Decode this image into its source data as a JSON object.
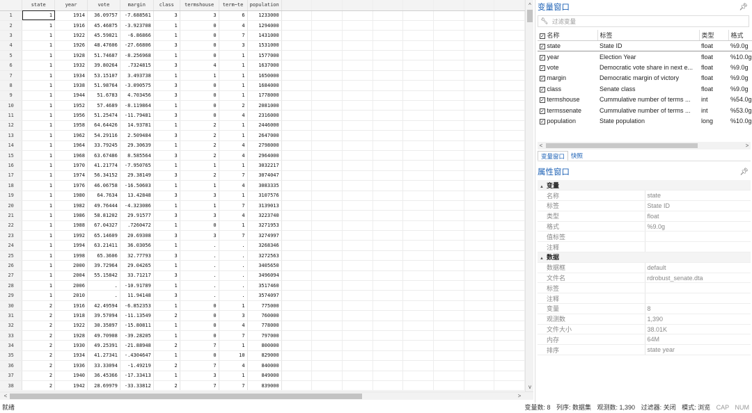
{
  "grid": {
    "columns": [
      "state",
      "year",
      "vote",
      "margin",
      "class",
      "termshouse",
      "term~te",
      "population"
    ],
    "rows": [
      [
        "1",
        "1914",
        "36.09757",
        "-7.688561",
        "3",
        "3",
        "6",
        "1233000"
      ],
      [
        "1",
        "1916",
        "45.46875",
        "-3.923708",
        "1",
        "0",
        "4",
        "1294000"
      ],
      [
        "1",
        "1922",
        "45.59821",
        "-6.86866",
        "1",
        "0",
        "7",
        "1431000"
      ],
      [
        "1",
        "1926",
        "48.47606",
        "-27.66806",
        "3",
        "0",
        "3",
        "1531000"
      ],
      [
        "1",
        "1928",
        "51.74687",
        "-8.256968",
        "1",
        "0",
        "1",
        "1577000"
      ],
      [
        "1",
        "1932",
        "39.80264",
        ".7324815",
        "3",
        "4",
        "1",
        "1637000"
      ],
      [
        "1",
        "1934",
        "53.15107",
        "3.493738",
        "1",
        "1",
        "1",
        "1650000"
      ],
      [
        "1",
        "1938",
        "51.98764",
        "-3.090575",
        "3",
        "0",
        "1",
        "1684000"
      ],
      [
        "1",
        "1944",
        "51.6783",
        "4.703456",
        "3",
        "0",
        "1",
        "1778000"
      ],
      [
        "1",
        "1952",
        "57.4689",
        "-8.119864",
        "1",
        "0",
        "2",
        "2081000"
      ],
      [
        "1",
        "1956",
        "51.25474",
        "-11.79481",
        "3",
        "0",
        "4",
        "2316000"
      ],
      [
        "1",
        "1958",
        "64.64426",
        "14.93781",
        "1",
        "2",
        "1",
        "2446000"
      ],
      [
        "1",
        "1962",
        "54.29116",
        "2.509484",
        "3",
        "2",
        "1",
        "2647000"
      ],
      [
        "1",
        "1964",
        "33.79245",
        "29.30639",
        "1",
        "2",
        "4",
        "2798000"
      ],
      [
        "1",
        "1968",
        "63.67486",
        "8.585564",
        "3",
        "2",
        "4",
        "2964000"
      ],
      [
        "1",
        "1970",
        "41.21774",
        "-7.950765",
        "1",
        "1",
        "1",
        "3032217"
      ],
      [
        "1",
        "1974",
        "56.34152",
        "29.38149",
        "3",
        "2",
        "7",
        "3074047"
      ],
      [
        "1",
        "1976",
        "46.06758",
        "-16.50603",
        "1",
        "1",
        "4",
        "3083335"
      ],
      [
        "1",
        "1980",
        "64.7634",
        "13.42848",
        "3",
        "3",
        "1",
        "3107576"
      ],
      [
        "1",
        "1982",
        "49.76444",
        "-4.323086",
        "1",
        "1",
        "7",
        "3139013"
      ],
      [
        "1",
        "1986",
        "58.81202",
        "29.91577",
        "3",
        "3",
        "4",
        "3223740"
      ],
      [
        "1",
        "1988",
        "67.04327",
        ".7260472",
        "1",
        "0",
        "1",
        "3271953"
      ],
      [
        "1",
        "1992",
        "65.14609",
        "20.69308",
        "3",
        "3",
        "7",
        "3274997"
      ],
      [
        "1",
        "1994",
        "63.21411",
        "36.03056",
        "1",
        ".",
        ".",
        "3268346"
      ],
      [
        "1",
        "1998",
        "65.3606",
        "32.77793",
        "3",
        ".",
        ".",
        "3272563"
      ],
      [
        "1",
        "2000",
        "39.72964",
        "29.04265",
        "1",
        ".",
        ".",
        "3405650"
      ],
      [
        "1",
        "2004",
        "55.15842",
        "33.71217",
        "3",
        ".",
        ".",
        "3496094"
      ],
      [
        "1",
        "2006",
        ".",
        "-10.91789",
        "1",
        ".",
        ".",
        "3517460"
      ],
      [
        "1",
        "2010",
        ".",
        "11.94148",
        "3",
        ".",
        ".",
        "3574097"
      ],
      [
        "2",
        "1916",
        "42.49594",
        "-6.852353",
        "1",
        "0",
        "1",
        "775000"
      ],
      [
        "2",
        "1918",
        "39.57094",
        "-11.13549",
        "2",
        "0",
        "3",
        "760000"
      ],
      [
        "2",
        "1922",
        "30.35897",
        "-15.80811",
        "1",
        "0",
        "4",
        "778000"
      ],
      [
        "2",
        "1928",
        "49.70908",
        "-39.28205",
        "1",
        "0",
        "7",
        "797000"
      ],
      [
        "2",
        "1930",
        "49.25391",
        "-21.88948",
        "2",
        "7",
        "1",
        "800000"
      ],
      [
        "2",
        "1934",
        "41.27341",
        "-.4304647",
        "1",
        "0",
        "10",
        "829000"
      ],
      [
        "2",
        "1936",
        "33.33094",
        "-1.49219",
        "2",
        "7",
        "4",
        "840000"
      ],
      [
        "2",
        "1940",
        "36.45366",
        "-17.33413",
        "1",
        "3",
        "1",
        "849000"
      ],
      [
        "2",
        "1942",
        "28.69979",
        "-33.33812",
        "2",
        "7",
        "7",
        "839000"
      ]
    ]
  },
  "variables_window": {
    "title": "变量窗口",
    "pin_icon": "pin-icon",
    "filter_placeholder": "过滤变量",
    "headers": [
      "名称",
      "标签",
      "类型",
      "格式"
    ],
    "variables": [
      {
        "name": "state",
        "label": "State ID",
        "type": "float",
        "format": "%9.0g"
      },
      {
        "name": "year",
        "label": "Election Year",
        "type": "float",
        "format": "%10.0g"
      },
      {
        "name": "vote",
        "label": "Democratic vote share in next e...",
        "type": "float",
        "format": "%9.0g"
      },
      {
        "name": "margin",
        "label": "Democratic margin of victory",
        "type": "float",
        "format": "%9.0g"
      },
      {
        "name": "class",
        "label": "Senate class",
        "type": "float",
        "format": "%9.0g"
      },
      {
        "name": "termshouse",
        "label": "Cummulative number of terms ...",
        "type": "int",
        "format": "%54.0g"
      },
      {
        "name": "termssenate",
        "label": "Cummulative number of terms ...",
        "type": "int",
        "format": "%53.0g"
      },
      {
        "name": "population",
        "label": "State population",
        "type": "long",
        "format": "%10.0g"
      }
    ],
    "tabs": [
      "变量窗口",
      "快照"
    ]
  },
  "properties_window": {
    "title": "属性窗口",
    "sections": [
      {
        "name": "变量",
        "rows": [
          {
            "label": "名称",
            "value": "state"
          },
          {
            "label": "标签",
            "value": "State ID"
          },
          {
            "label": "类型",
            "value": "float"
          },
          {
            "label": "格式",
            "value": "%9.0g"
          },
          {
            "label": "值标签",
            "value": ""
          },
          {
            "label": "注释",
            "value": ""
          }
        ]
      },
      {
        "name": "数据",
        "rows": [
          {
            "label": "数据框",
            "value": "default"
          },
          {
            "label": "文件名",
            "value": "rdrobust_senate.dta"
          },
          {
            "label": "标签",
            "value": ""
          },
          {
            "label": "注释",
            "value": ""
          },
          {
            "label": "变量",
            "value": "8"
          },
          {
            "label": "观测数",
            "value": "1,390"
          },
          {
            "label": "文件大小",
            "value": "38.01K"
          },
          {
            "label": "内存",
            "value": "64M"
          },
          {
            "label": "排序",
            "value": "state year"
          }
        ]
      }
    ]
  },
  "status_bar": {
    "ready": "就绪",
    "vars": "变量数: 8",
    "order": "列序: 数据集",
    "obs": "观测数: 1,390",
    "filter": "过滤器: 关闭",
    "mode": "模式: 浏览",
    "cap": "CAP",
    "num": "NUM"
  }
}
